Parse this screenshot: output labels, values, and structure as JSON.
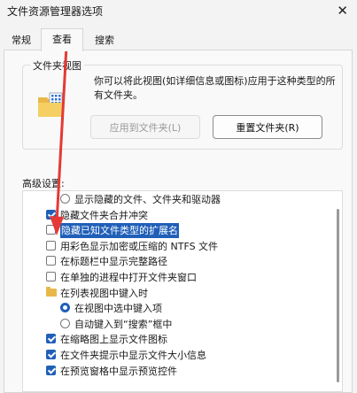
{
  "window": {
    "title": "文件资源管理器选项",
    "close_glyph": "✕"
  },
  "tabs": [
    {
      "label": "常规",
      "active": false
    },
    {
      "label": "查看",
      "active": true
    },
    {
      "label": "搜索",
      "active": false
    }
  ],
  "folder_views": {
    "legend": "文件夹视图",
    "description": "你可以将此视图(如详细信息或图标)应用于这种类型的所有文件夹。",
    "apply_button": "应用到文件夹(L)",
    "reset_button": "重置文件夹(R)"
  },
  "advanced": {
    "label": "高级设置:",
    "items": [
      {
        "kind": "radio",
        "checked": false,
        "indent": 2,
        "label": "显示隐藏的文件、文件夹和驱动器"
      },
      {
        "kind": "checkbox",
        "checked": true,
        "indent": 1,
        "label": "隐藏文件夹合并冲突"
      },
      {
        "kind": "checkbox",
        "checked": false,
        "indent": 1,
        "label": "隐藏已知文件类型的扩展名",
        "highlight": true
      },
      {
        "kind": "checkbox",
        "checked": false,
        "indent": 1,
        "label": "用彩色显示加密或压缩的 NTFS 文件"
      },
      {
        "kind": "checkbox",
        "checked": false,
        "indent": 1,
        "label": "在标题栏中显示完整路径"
      },
      {
        "kind": "checkbox",
        "checked": false,
        "indent": 1,
        "label": "在单独的进程中打开文件夹窗口"
      },
      {
        "kind": "folder",
        "indent": 1,
        "label": "在列表视图中键入时"
      },
      {
        "kind": "radio",
        "checked": true,
        "indent": 2,
        "label": "在视图中选中键入项"
      },
      {
        "kind": "radio",
        "checked": false,
        "indent": 2,
        "label": "自动键入到“搜索”框中"
      },
      {
        "kind": "checkbox",
        "checked": true,
        "indent": 1,
        "label": "在缩略图上显示文件图标"
      },
      {
        "kind": "checkbox",
        "checked": true,
        "indent": 1,
        "label": "在文件夹提示中显示文件大小信息"
      },
      {
        "kind": "checkbox",
        "checked": true,
        "indent": 1,
        "label": "在预览窗格中显示预览控件"
      }
    ]
  },
  "colors": {
    "accent": "#1f5fb8",
    "annotation_arrow": "#e53935"
  }
}
